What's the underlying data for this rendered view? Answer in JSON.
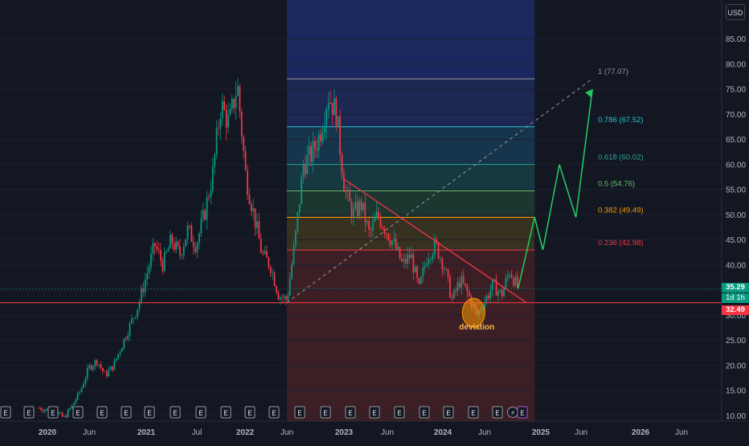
{
  "toolbar": {
    "currency": "USD"
  },
  "price_axis": {
    "labels": [
      "85.00",
      "80.00",
      "75.00",
      "70.00",
      "65.00",
      "60.00",
      "55.00",
      "50.00",
      "45.00",
      "40.00",
      "35.00",
      "30.00",
      "25.00",
      "20.00",
      "15.00",
      "10.00"
    ],
    "values": [
      85,
      80,
      75,
      70,
      65,
      60,
      55,
      50,
      45,
      40,
      35,
      30,
      25,
      20,
      15,
      10
    ]
  },
  "time_axis": {
    "labels": [
      "2020",
      "Jun",
      "2021",
      "Jul",
      "2022",
      "Jun",
      "2023",
      "Jun",
      "2024",
      "Jun",
      "2025",
      "Jun",
      "2026",
      "Jun"
    ]
  },
  "price_tags": {
    "last_price": "35.29",
    "countdown": "1d 1h",
    "support": "32.49"
  },
  "fib_levels": [
    {
      "label": "1 (77.07)",
      "value": 77.07,
      "color": "#9598a1"
    },
    {
      "label": "0.786 (67.52)",
      "value": 67.52,
      "color": "#26c6da"
    },
    {
      "label": "0.618 (60.02)",
      "value": 60.02,
      "color": "#26a69a"
    },
    {
      "label": "0.5 (54.76)",
      "value": 54.76,
      "color": "#66bb6a"
    },
    {
      "label": "0.382 (49.49)",
      "value": 49.49,
      "color": "#ff9800"
    },
    {
      "label": "0.236 (42.98)",
      "value": 42.98,
      "color": "#f23645"
    }
  ],
  "annotations": {
    "deviation_label": "deviation"
  },
  "event_markers": [
    "E",
    "E",
    "E",
    "E",
    "E",
    "E",
    "E",
    "E",
    "E",
    "E",
    "E",
    "E",
    "E",
    "E",
    "E",
    "E",
    "E",
    "E",
    "E",
    "E",
    "E",
    "⚡",
    "E"
  ],
  "chart_data": {
    "type": "candlestick",
    "price_range": [
      10,
      87
    ],
    "last_price": 35.29,
    "support_level": 32.49,
    "close_path": [
      [
        "2019-12",
        11.5
      ],
      [
        "2020-02",
        10.8
      ],
      [
        "2020-03",
        9.5
      ],
      [
        "2020-04",
        12.0
      ],
      [
        "2020-05",
        15.0
      ],
      [
        "2020-06",
        19.5
      ],
      [
        "2020-07",
        21.0
      ],
      [
        "2020-08",
        18.0
      ],
      [
        "2020-09",
        20.0
      ],
      [
        "2020-10",
        24.0
      ],
      [
        "2020-11",
        28.0
      ],
      [
        "2020-12",
        32.0
      ],
      [
        "2021-01",
        38.0
      ],
      [
        "2021-02",
        44.0
      ],
      [
        "2021-03",
        40.0
      ],
      [
        "2021-04",
        45.0
      ],
      [
        "2021-05",
        42.0
      ],
      [
        "2021-06",
        47.0
      ],
      [
        "2021-07",
        44.0
      ],
      [
        "2021-08",
        50.0
      ],
      [
        "2021-09",
        58.0
      ],
      [
        "2021-10",
        72.0
      ],
      [
        "2021-11",
        68.0
      ],
      [
        "2021-12",
        76.0
      ],
      [
        "2022-01",
        58.0
      ],
      [
        "2022-02",
        50.0
      ],
      [
        "2022-03",
        42.0
      ],
      [
        "2022-04",
        40.0
      ],
      [
        "2022-05",
        34.0
      ],
      [
        "2022-06",
        33.0
      ],
      [
        "2022-07",
        45.0
      ],
      [
        "2022-08",
        60.0
      ],
      [
        "2022-09",
        62.0
      ],
      [
        "2022-10",
        66.0
      ],
      [
        "2022-11",
        74.0
      ],
      [
        "2022-12",
        70.0
      ],
      [
        "2023-01",
        55.0
      ],
      [
        "2023-02",
        50.0
      ],
      [
        "2023-03",
        52.0
      ],
      [
        "2023-04",
        46.0
      ],
      [
        "2023-05",
        50.0
      ],
      [
        "2023-06",
        47.0
      ],
      [
        "2023-07",
        44.0
      ],
      [
        "2023-08",
        40.0
      ],
      [
        "2023-09",
        42.0
      ],
      [
        "2023-10",
        35.0
      ],
      [
        "2023-11",
        42.0
      ],
      [
        "2023-12",
        44.0
      ],
      [
        "2024-01",
        40.0
      ],
      [
        "2024-02",
        33.0
      ],
      [
        "2024-03",
        37.0
      ],
      [
        "2024-04",
        34.0
      ],
      [
        "2024-05",
        30.0
      ],
      [
        "2024-06",
        33.0
      ],
      [
        "2024-07",
        36.0
      ],
      [
        "2024-08",
        34.0
      ],
      [
        "2024-09",
        39.0
      ],
      [
        "2024-10",
        35.29
      ]
    ],
    "projection": [
      [
        "2024-10",
        35.3
      ],
      [
        "2024-12",
        49.5
      ],
      [
        "2025-01",
        43.0
      ],
      [
        "2025-03",
        60.0
      ],
      [
        "2025-05",
        49.5
      ],
      [
        "2025-07",
        75.0
      ]
    ],
    "trendline": [
      [
        "2023-01",
        57.0
      ],
      [
        "2024-11",
        32.5
      ]
    ],
    "diagonal": [
      [
        "2022-06",
        32.5
      ],
      [
        "2025-07",
        77.07
      ]
    ],
    "fib_zone_dates": [
      "2022-06",
      "2024-12"
    ]
  }
}
